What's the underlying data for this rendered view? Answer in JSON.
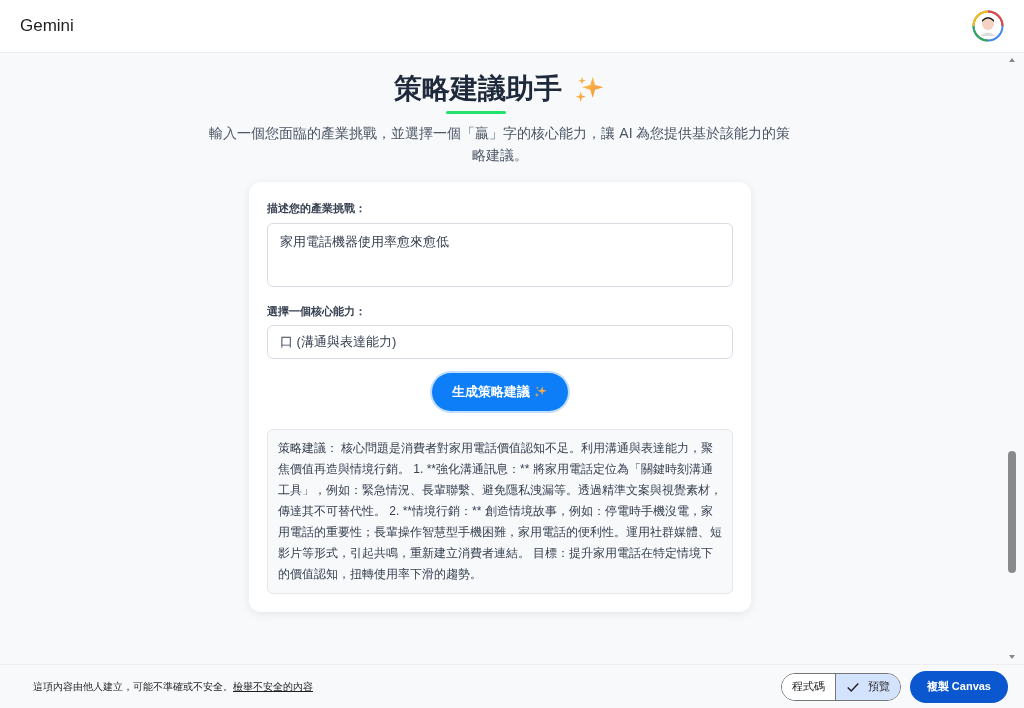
{
  "header": {
    "title": "Gemini"
  },
  "page": {
    "title": "策略建議助手",
    "subtitle": "輸入一個您面臨的產業挑戰，並選擇一個「贏」字的核心能力，讓 AI 為您提供基於該能力的策略建議。"
  },
  "form": {
    "challenge_label": "描述您的產業挑戰：",
    "challenge_value": "家用電話機器使用率愈來愈低",
    "ability_label": "選擇一個核心能力：",
    "ability_value": "口 (溝通與表達能力)",
    "submit": "生成策略建議"
  },
  "result": "策略建議： 核心問題是消費者對家用電話價值認知不足。利用溝通與表達能力，聚焦價值再造與情境行銷。 1. **強化溝通訊息：** 將家用電話定位為「關鍵時刻溝通工具」，例如：緊急情況、長輩聯繫、避免隱私洩漏等。透過精準文案與視覺素材，傳達其不可替代性。 2. **情境行銷：** 創造情境故事，例如：停電時手機沒電，家用電話的重要性；長輩操作智慧型手機困難，家用電話的便利性。運用社群媒體、短影片等形式，引起共鳴，重新建立消費者連結。 目標：提升家用電話在特定情境下的價值認知，扭轉使用率下滑的趨勢。",
  "footer": {
    "notice": "這項內容由他人建立，可能不準確或不安全。",
    "report_link": "檢舉不安全的內容",
    "view_toggle": [
      {
        "label": "程式碼",
        "selected": false
      },
      {
        "label": "預覽",
        "selected": true
      }
    ],
    "copy_button": "複製 Canvas"
  }
}
